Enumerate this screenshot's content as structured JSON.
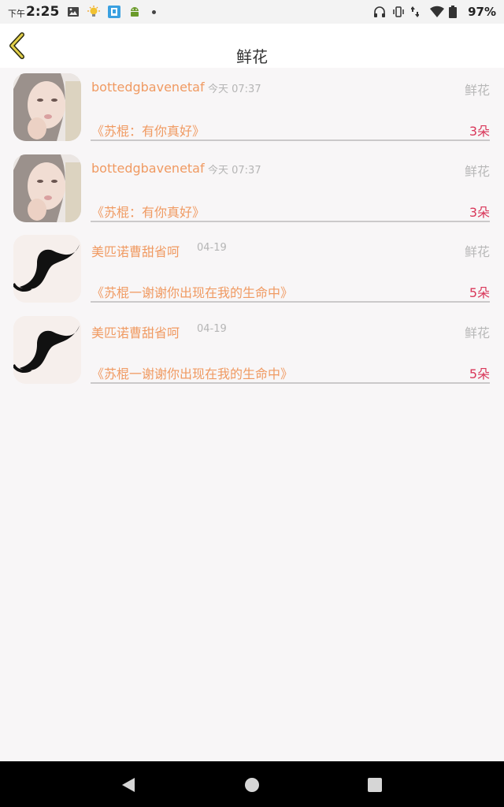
{
  "status_bar": {
    "ampm": "下午",
    "time": "2:25",
    "battery": "97%"
  },
  "header": {
    "title": "鲜花"
  },
  "gifts": [
    {
      "username": "bottedgbavenetaf",
      "time": "今天 07:37",
      "type": "鲜花",
      "message": "《苏棍：有你真好》",
      "count": "3朵",
      "avatar": "woman-photo"
    },
    {
      "username": "bottedgbavenetaf",
      "time": "今天 07:37",
      "type": "鲜花",
      "message": "《苏棍：有你真好》",
      "count": "3朵",
      "avatar": "woman-photo"
    },
    {
      "username": "美匹诺曹甜省呵",
      "time": "04-19",
      "type": "鲜花",
      "message": "《苏棍一谢谢你出现在我的生命中》",
      "count": "5朵",
      "avatar": "mustache"
    },
    {
      "username": "美匹诺曹甜省呵",
      "time": "04-19",
      "type": "鲜花",
      "message": "《苏棍一谢谢你出现在我的生命中》",
      "count": "5朵",
      "avatar": "mustache"
    }
  ],
  "colors": {
    "accent_orange": "#f09a62",
    "count_red": "#d9375a",
    "back_arrow": "#b49a1c"
  }
}
